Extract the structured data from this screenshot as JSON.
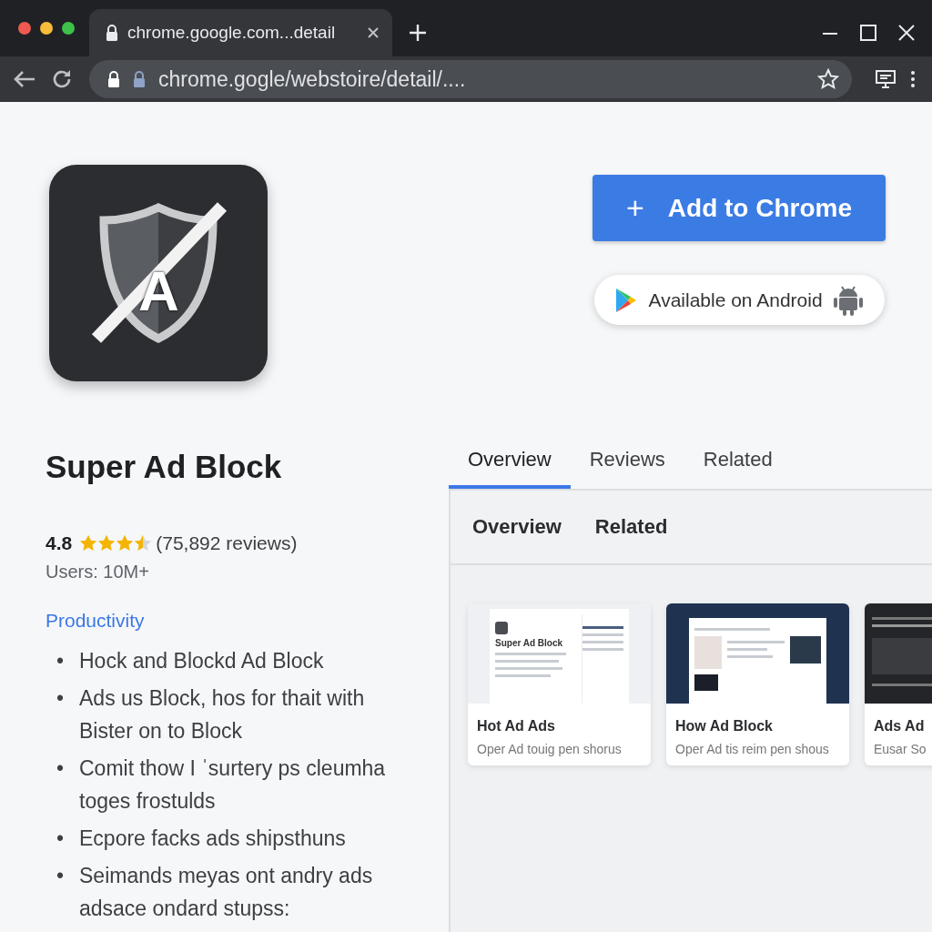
{
  "window": {
    "tab_title": "chrome.google.com...detail",
    "url": "chrome.gogle/webstoire/detail/...."
  },
  "extension": {
    "logo_letter": "A",
    "name": "Super Ad Block",
    "rating": "4.8",
    "stars": 3.5,
    "review_count": "(75,892 reviews)",
    "users": "Users: 10M+",
    "category": "Productivity",
    "features": [
      {
        "bullet": "•",
        "text": "Hock and Blockd Ad Block"
      },
      {
        "bullet": "•",
        "text": "Ads us Block, hos for thait with Bister on to Block"
      },
      {
        "bullet": "•",
        "text": "Comit thow I ˈsurtery ps cleumha toges frostulds"
      },
      {
        "bullet": "•",
        "text": "Ecpore facks ads shipsthuns"
      },
      {
        "bullet": "•",
        "text": "Seimands meyas ont andry ads adsace ondard stupss:"
      }
    ]
  },
  "actions": {
    "add_icon": "+",
    "add_button": "Add to Chrome",
    "android_badge": "Available on Android"
  },
  "tabs": [
    {
      "label": "Overview",
      "selected": true
    },
    {
      "label": "Reviews",
      "selected": false
    },
    {
      "label": "Related",
      "selected": false
    }
  ],
  "subtabs": [
    {
      "label": "Overview"
    },
    {
      "label": "Related"
    }
  ],
  "screenshots": [
    {
      "kind": "light",
      "thumbnail_text": "Super Ad Block",
      "title": "Hot Ad Ads",
      "caption": "Oper Ad touig pen shorus"
    },
    {
      "kind": "navy",
      "title": "How Ad Block",
      "caption": "Oper Ad tis reim pen shous"
    },
    {
      "kind": "dark",
      "title": "Ads Ad",
      "caption": "Eusar So"
    }
  ]
}
